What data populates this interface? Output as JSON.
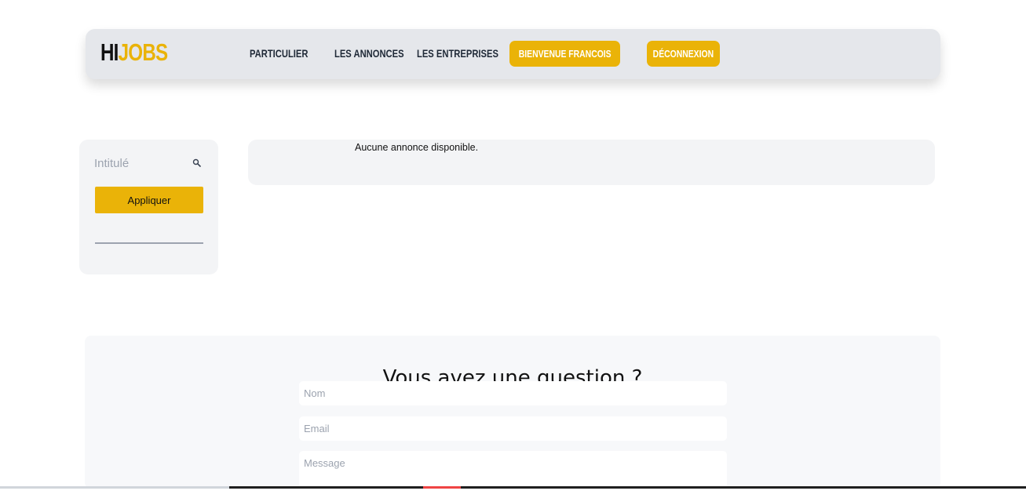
{
  "header": {
    "logo": {
      "part1": "HI",
      "part2": "JOBS"
    },
    "nav": [
      {
        "label": "PARTICULIER"
      },
      {
        "label": "LES ANNONCES"
      },
      {
        "label": "LES ENTREPRISES"
      }
    ],
    "welcome_button": "BIENVENUE FRANCOIS",
    "logout_button": "DÉCONNEXION"
  },
  "filters": {
    "search": {
      "placeholder": "Intitulé",
      "value": "",
      "icon": "search-icon"
    },
    "apply_label": "Appliquer"
  },
  "results": {
    "empty_message": "Aucune annonce disponible."
  },
  "contact": {
    "title": "Vous avez une question ?",
    "name_placeholder": "Nom",
    "email_placeholder": "Email",
    "message_placeholder": "Message"
  },
  "colors": {
    "accent": "#eab308",
    "header_bg": "#e5e7eb",
    "panel_bg": "#f3f4f6"
  }
}
